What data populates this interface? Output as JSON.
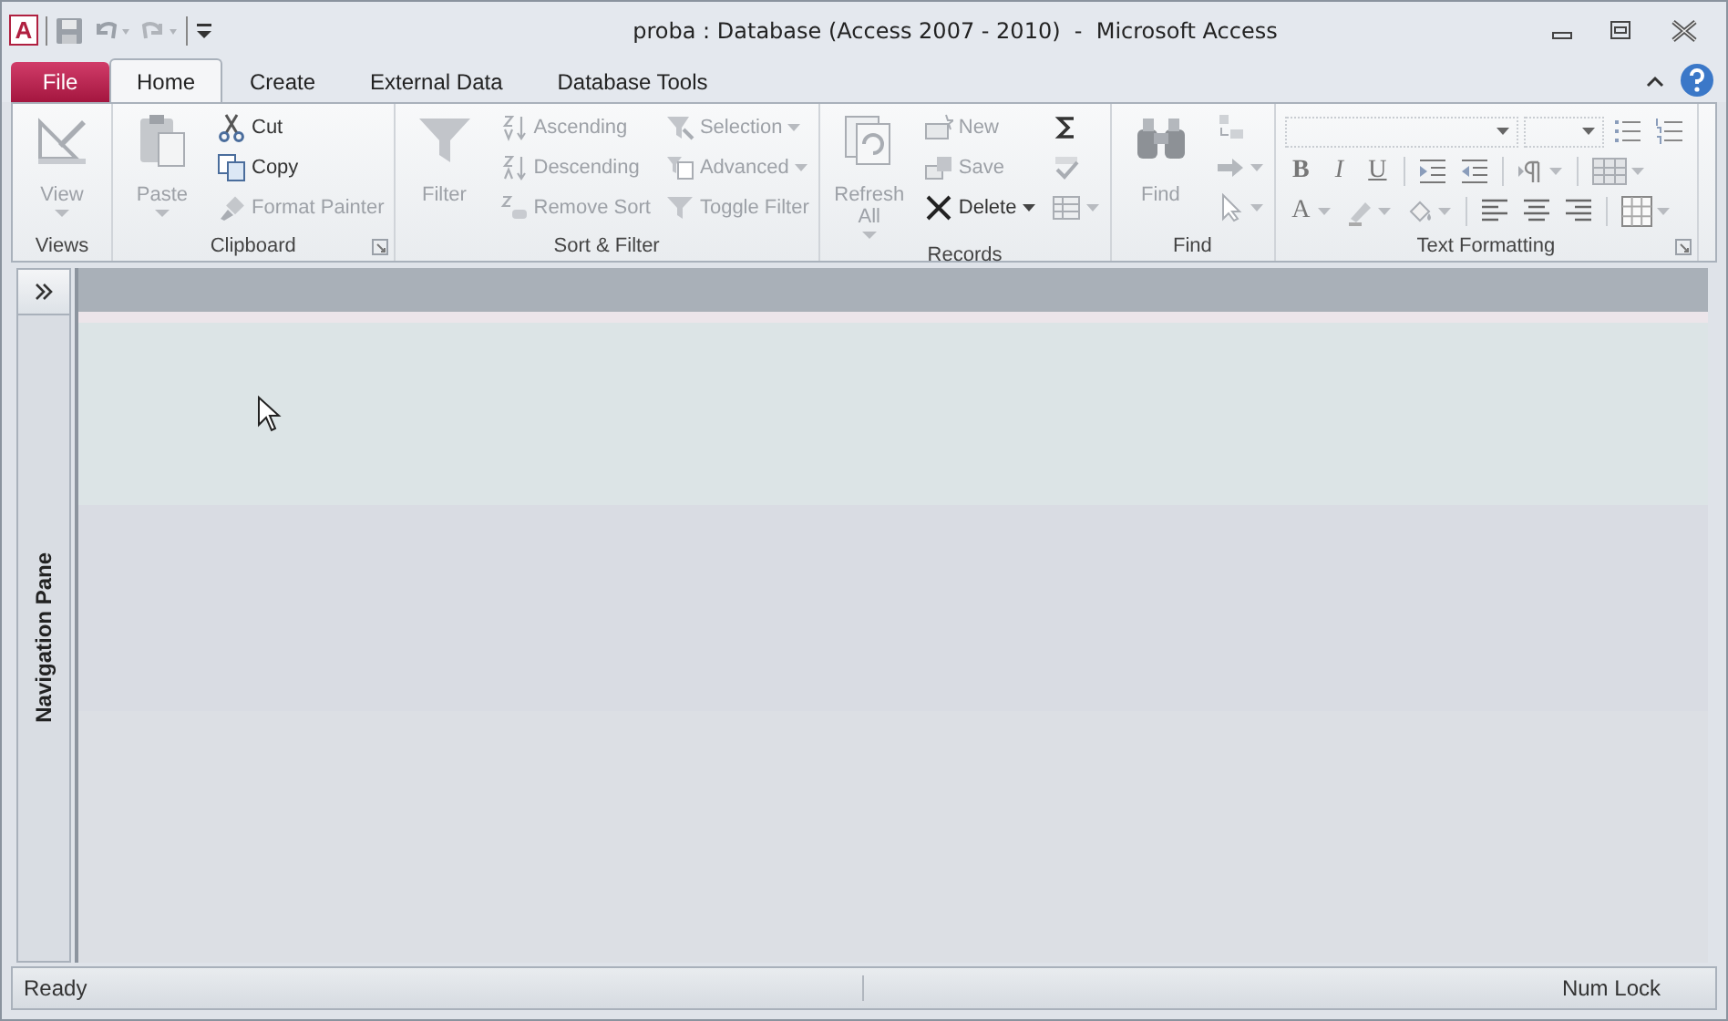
{
  "window": {
    "title": "proba : Database (Access 2007 - 2010)  -  Microsoft Access",
    "app_letter": "A"
  },
  "tabs": [
    {
      "label": "File",
      "kind": "file",
      "selected": false
    },
    {
      "label": "Home",
      "kind": "tab",
      "selected": true
    },
    {
      "label": "Create",
      "kind": "tab",
      "selected": false
    },
    {
      "label": "External Data",
      "kind": "tab",
      "selected": false
    },
    {
      "label": "Database Tools",
      "kind": "tab",
      "selected": false
    }
  ],
  "ribbon_groups": [
    {
      "label": "Views",
      "kind": "columns",
      "launcher": false,
      "columns": [
        [
          {
            "kind": "large",
            "label": "View",
            "disabled": true,
            "dropdown": true
          }
        ]
      ]
    },
    {
      "label": "Clipboard",
      "kind": "columns",
      "launcher": true,
      "columns": [
        [
          {
            "kind": "large",
            "label": "Paste",
            "disabled": true,
            "dropdown": true
          }
        ],
        [
          {
            "kind": "small",
            "label": "Cut",
            "disabled": false,
            "dropdown": false
          },
          {
            "kind": "small",
            "label": "Copy",
            "disabled": false,
            "dropdown": false
          },
          {
            "kind": "small",
            "label": "Format Painter",
            "disabled": true,
            "dropdown": false
          }
        ]
      ]
    },
    {
      "label": "Sort & Filter",
      "kind": "columns",
      "launcher": false,
      "columns": [
        [
          {
            "kind": "large",
            "label": "Filter",
            "disabled": true,
            "dropdown": false
          }
        ],
        [
          {
            "kind": "small",
            "label": "Ascending",
            "disabled": true,
            "dropdown": false
          },
          {
            "kind": "small",
            "label": "Descending",
            "disabled": true,
            "dropdown": false
          },
          {
            "kind": "small",
            "label": "Remove Sort",
            "disabled": true,
            "dropdown": false
          }
        ],
        [
          {
            "kind": "small",
            "label": "Selection",
            "disabled": true,
            "dropdown": true
          },
          {
            "kind": "small",
            "label": "Advanced",
            "disabled": true,
            "dropdown": true
          },
          {
            "kind": "small",
            "label": "Toggle Filter",
            "disabled": true,
            "dropdown": false
          }
        ]
      ]
    },
    {
      "label": "Records",
      "kind": "columns",
      "launcher": false,
      "columns": [
        [
          {
            "kind": "large",
            "label": "Refresh All",
            "disabled": true,
            "dropdown": true
          }
        ],
        [
          {
            "kind": "small",
            "label": "New",
            "disabled": true,
            "dropdown": false
          },
          {
            "kind": "small",
            "label": "Save",
            "disabled": true,
            "dropdown": false
          },
          {
            "kind": "small",
            "label": "Delete",
            "disabled": false,
            "dropdown": true
          }
        ],
        [
          {
            "kind": "small",
            "disabled": false,
            "dropdown": false
          },
          {
            "kind": "small",
            "disabled": true,
            "dropdown": false
          },
          {
            "kind": "small",
            "disabled": true,
            "dropdown": true
          }
        ]
      ]
    },
    {
      "label": "Find",
      "kind": "columns",
      "launcher": false,
      "columns": [
        [
          {
            "kind": "large",
            "label": "Find",
            "disabled": true,
            "dropdown": false
          }
        ],
        [
          {
            "kind": "small",
            "disabled": true,
            "dropdown": false
          },
          {
            "kind": "small",
            "disabled": true,
            "dropdown": true
          },
          {
            "kind": "small",
            "disabled": true,
            "dropdown": true
          }
        ]
      ]
    },
    {
      "label": "Text Formatting",
      "kind": "rows",
      "launcher": true,
      "rows": [
        [
          {
            "kind": "combo"
          },
          {
            "kind": "combo"
          },
          {
            "kind": "icon",
            "disabled": true,
            "dropdown": false
          },
          {
            "kind": "icon",
            "disabled": true,
            "dropdown": false
          }
        ],
        [
          {
            "kind": "text",
            "text": "B",
            "disabled": true,
            "dropdown": false
          },
          {
            "kind": "text",
            "text": "I",
            "disabled": true,
            "dropdown": false
          },
          {
            "kind": "text",
            "text": "U",
            "disabled": true,
            "dropdown": false
          },
          {
            "kind": "separator"
          },
          {
            "kind": "icon",
            "disabled": true,
            "dropdown": false
          },
          {
            "kind": "icon",
            "disabled": true,
            "dropdown": false
          },
          {
            "kind": "separator"
          },
          {
            "kind": "icon",
            "disabled": true,
            "dropdown": true
          },
          {
            "kind": "separator"
          },
          {
            "kind": "icon",
            "disabled": true,
            "dropdown": true
          }
        ],
        [
          {
            "kind": "text",
            "text": "A",
            "disabled": true,
            "dropdown": true
          },
          {
            "kind": "icon",
            "disabled": true,
            "dropdown": true
          },
          {
            "kind": "icon",
            "disabled": true,
            "dropdown": true
          },
          {
            "kind": "separator"
          },
          {
            "kind": "icon",
            "disabled": true,
            "dropdown": false
          },
          {
            "kind": "icon",
            "disabled": true,
            "dropdown": false
          },
          {
            "kind": "icon",
            "disabled": true,
            "dropdown": false
          },
          {
            "kind": "separator"
          },
          {
            "kind": "icon",
            "disabled": true,
            "dropdown": true
          }
        ]
      ]
    }
  ],
  "navigation_pane": {
    "label": "Navigation Pane",
    "expanded": false
  },
  "status_bar": {
    "left": "Ready",
    "right": "Num Lock"
  }
}
